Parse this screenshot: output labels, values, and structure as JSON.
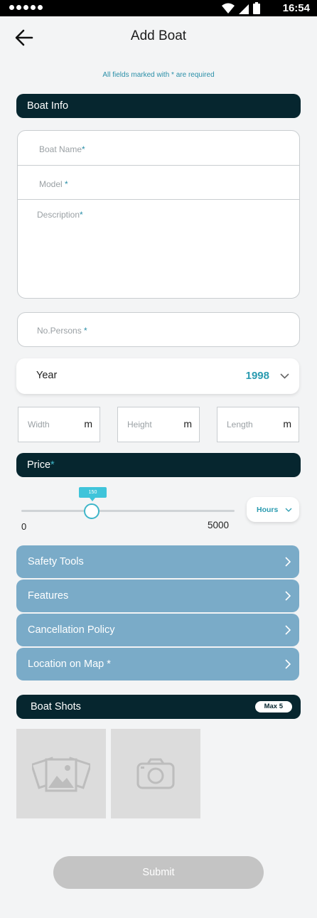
{
  "status_bar": {
    "time": "16:54"
  },
  "header": {
    "title": "Add Boat"
  },
  "required_note": "All fields marked with * are required",
  "boat_info": {
    "section_title": "Boat Info",
    "boat_name_placeholder": "Boat Name",
    "model_placeholder": "Model ",
    "description_placeholder": "Description",
    "persons_placeholder": "No.Persons ",
    "required_mark": "*"
  },
  "year": {
    "label": "Year",
    "value": "1998"
  },
  "dimensions": [
    {
      "placeholder": "Width",
      "unit": "m"
    },
    {
      "placeholder": "Height",
      "unit": "m"
    },
    {
      "placeholder": "Length",
      "unit": "m"
    }
  ],
  "price": {
    "section_title": "Price",
    "required_mark": "*",
    "slider_value": "150",
    "slider_min": "0",
    "slider_max": "5000",
    "unit_select": "Hours"
  },
  "nav_rows": [
    {
      "label": "Safety Tools"
    },
    {
      "label": "Features"
    },
    {
      "label": "Cancellation Policy"
    },
    {
      "label": "Location on Map *"
    }
  ],
  "boat_shots": {
    "section_title": "Boat Shots",
    "max_badge": "Max 5"
  },
  "submit_label": "Submit",
  "colors": {
    "dark_bar": "#06262f",
    "accent": "#2a9bb0",
    "nav_row": "#7aabc8",
    "slider": "#3fb6c9"
  },
  "icons": [
    "back-arrow-icon",
    "gallery-icon",
    "camera-icon",
    "chevron-right-icon",
    "chevron-down-icon",
    "wifi-icon",
    "signal-icon",
    "battery-icon"
  ]
}
